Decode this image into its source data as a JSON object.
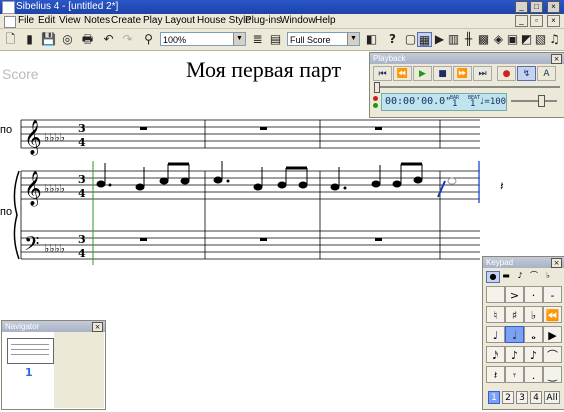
{
  "window": {
    "title": "Sibelius 4 - [untitled 2*]"
  },
  "menu": [
    "File",
    "Edit",
    "View",
    "Notes",
    "Create",
    "Play",
    "Layout",
    "House Style",
    "Plug-ins",
    "Window",
    "Help"
  ],
  "toolbar": {
    "zoom_value": "100%",
    "view_value": "Full Score"
  },
  "score": {
    "label": "Score",
    "title": "Моя первая парт",
    "instruments": [
      "по",
      "по"
    ]
  },
  "playback": {
    "title": "Playback",
    "timecode": "00:00'00.0\"",
    "bar_label": "BAR",
    "bar": "1",
    "beat_label": "BEAT",
    "beat": "1",
    "tempo": "♩=100"
  },
  "keypad": {
    "title": "Keypad",
    "tabs": [
      "1",
      "2",
      "3",
      "4",
      "All"
    ],
    "active_tab": "1"
  },
  "navigator": {
    "title": "Navigator",
    "page_number": "1"
  },
  "colors": {
    "titlebar": "#2055c0",
    "panel_bg": "#ece9d8",
    "highlight": "#3a6be0",
    "cursor_line": "#1a3ab5",
    "record_red": "#cc2222",
    "play_green": "#1a9a1a"
  }
}
